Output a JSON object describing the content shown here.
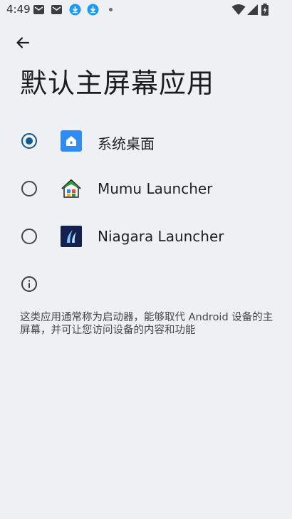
{
  "status_bar": {
    "time": "4:49"
  },
  "header": {
    "title": "默认主屏幕应用"
  },
  "options": [
    {
      "label": "系统桌面",
      "icon": "home-app-icon",
      "selected": true
    },
    {
      "label": "Mumu Launcher",
      "icon": "mumu-launcher-icon",
      "selected": false
    },
    {
      "label": "Niagara Launcher",
      "icon": "niagara-launcher-icon",
      "selected": false
    }
  ],
  "footer": {
    "description": "这类应用通常称为启动器，能够取代 Android 设备的主屏幕，并可让您访问设备的内容和功能"
  },
  "colors": {
    "background": "#eff0f3",
    "radio_selected": "#115a8b",
    "system_icon_blue": "#2f8cf5",
    "niagara_icon_navy": "#14204e"
  }
}
